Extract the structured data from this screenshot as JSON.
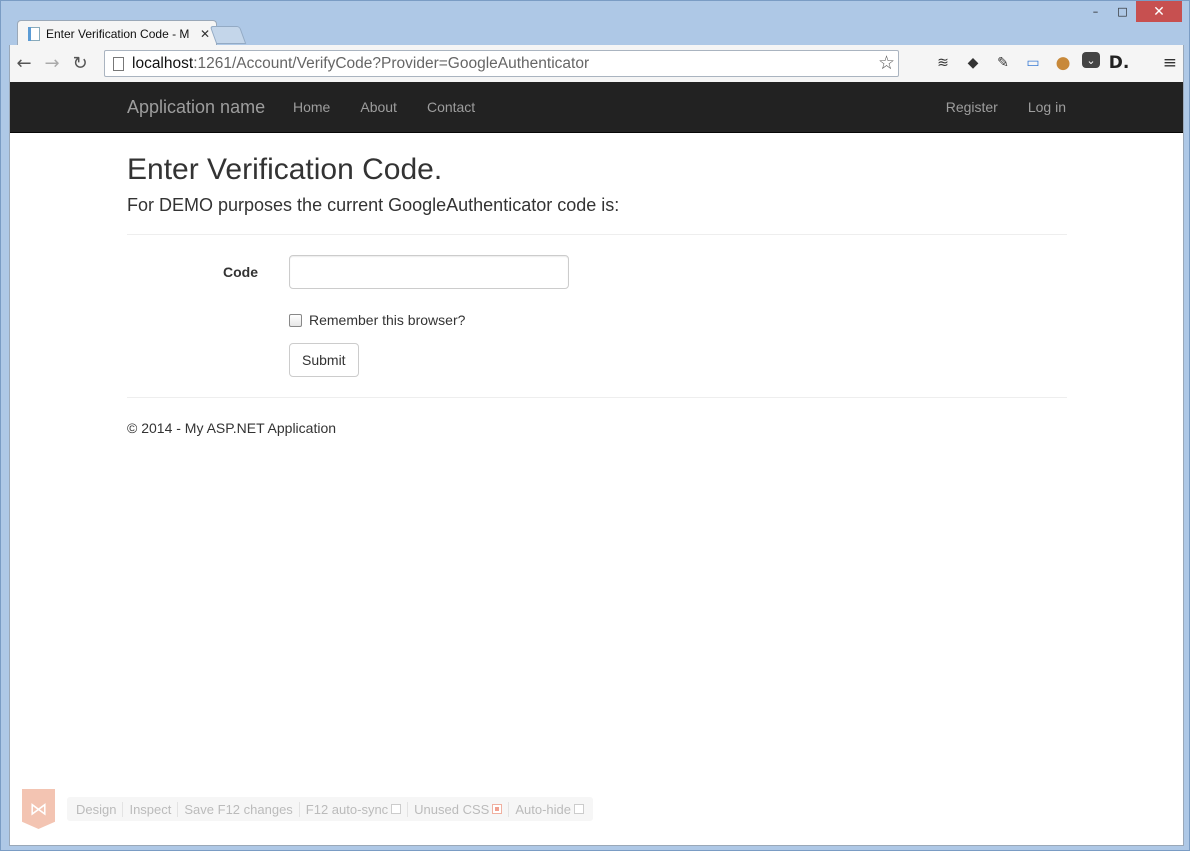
{
  "browser": {
    "tab_title": "Enter Verification Code - M",
    "url_host": "localhost",
    "url_path": ":1261/Account/VerifyCode?Provider=GoogleAuthenticator",
    "window_controls": {
      "minimize": "–",
      "maximize": "□",
      "close": "✕"
    },
    "extensions": [
      "windows-logo-icon",
      "buffer-icon",
      "feedly-icon",
      "evernote-icon",
      "screenshot-icon",
      "cookie-icon",
      "pocket-icon",
      "d-logo-icon"
    ]
  },
  "navbar": {
    "brand": "Application name",
    "links": [
      "Home",
      "About",
      "Contact"
    ],
    "right_links": [
      "Register",
      "Log in"
    ]
  },
  "page": {
    "title": "Enter Verification Code.",
    "subtitle": "For DEMO purposes the current GoogleAuthenticator code is:",
    "form": {
      "code_label": "Code",
      "code_value": "",
      "remember_label": "Remember this browser?",
      "remember_checked": false,
      "submit_label": "Submit"
    },
    "footer": "© 2014 - My ASP.NET Application"
  },
  "browser_link": {
    "items": [
      "Design",
      "Inspect",
      "Save F12 changes",
      "F12 auto-sync",
      "Unused CSS",
      "Auto-hide"
    ]
  }
}
